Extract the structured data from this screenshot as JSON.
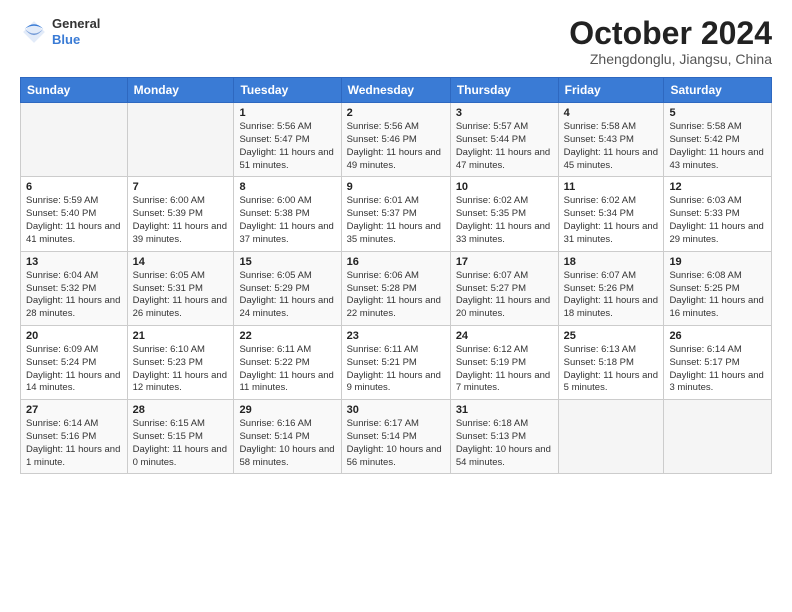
{
  "logo": {
    "general": "General",
    "blue": "Blue"
  },
  "title": "October 2024",
  "location": "Zhengdonglu, Jiangsu, China",
  "weekdays": [
    "Sunday",
    "Monday",
    "Tuesday",
    "Wednesday",
    "Thursday",
    "Friday",
    "Saturday"
  ],
  "weeks": [
    [
      {
        "day": "",
        "info": ""
      },
      {
        "day": "",
        "info": ""
      },
      {
        "day": "1",
        "info": "Sunrise: 5:56 AM\nSunset: 5:47 PM\nDaylight: 11 hours and 51 minutes."
      },
      {
        "day": "2",
        "info": "Sunrise: 5:56 AM\nSunset: 5:46 PM\nDaylight: 11 hours and 49 minutes."
      },
      {
        "day": "3",
        "info": "Sunrise: 5:57 AM\nSunset: 5:44 PM\nDaylight: 11 hours and 47 minutes."
      },
      {
        "day": "4",
        "info": "Sunrise: 5:58 AM\nSunset: 5:43 PM\nDaylight: 11 hours and 45 minutes."
      },
      {
        "day": "5",
        "info": "Sunrise: 5:58 AM\nSunset: 5:42 PM\nDaylight: 11 hours and 43 minutes."
      }
    ],
    [
      {
        "day": "6",
        "info": "Sunrise: 5:59 AM\nSunset: 5:40 PM\nDaylight: 11 hours and 41 minutes."
      },
      {
        "day": "7",
        "info": "Sunrise: 6:00 AM\nSunset: 5:39 PM\nDaylight: 11 hours and 39 minutes."
      },
      {
        "day": "8",
        "info": "Sunrise: 6:00 AM\nSunset: 5:38 PM\nDaylight: 11 hours and 37 minutes."
      },
      {
        "day": "9",
        "info": "Sunrise: 6:01 AM\nSunset: 5:37 PM\nDaylight: 11 hours and 35 minutes."
      },
      {
        "day": "10",
        "info": "Sunrise: 6:02 AM\nSunset: 5:35 PM\nDaylight: 11 hours and 33 minutes."
      },
      {
        "day": "11",
        "info": "Sunrise: 6:02 AM\nSunset: 5:34 PM\nDaylight: 11 hours and 31 minutes."
      },
      {
        "day": "12",
        "info": "Sunrise: 6:03 AM\nSunset: 5:33 PM\nDaylight: 11 hours and 29 minutes."
      }
    ],
    [
      {
        "day": "13",
        "info": "Sunrise: 6:04 AM\nSunset: 5:32 PM\nDaylight: 11 hours and 28 minutes."
      },
      {
        "day": "14",
        "info": "Sunrise: 6:05 AM\nSunset: 5:31 PM\nDaylight: 11 hours and 26 minutes."
      },
      {
        "day": "15",
        "info": "Sunrise: 6:05 AM\nSunset: 5:29 PM\nDaylight: 11 hours and 24 minutes."
      },
      {
        "day": "16",
        "info": "Sunrise: 6:06 AM\nSunset: 5:28 PM\nDaylight: 11 hours and 22 minutes."
      },
      {
        "day": "17",
        "info": "Sunrise: 6:07 AM\nSunset: 5:27 PM\nDaylight: 11 hours and 20 minutes."
      },
      {
        "day": "18",
        "info": "Sunrise: 6:07 AM\nSunset: 5:26 PM\nDaylight: 11 hours and 18 minutes."
      },
      {
        "day": "19",
        "info": "Sunrise: 6:08 AM\nSunset: 5:25 PM\nDaylight: 11 hours and 16 minutes."
      }
    ],
    [
      {
        "day": "20",
        "info": "Sunrise: 6:09 AM\nSunset: 5:24 PM\nDaylight: 11 hours and 14 minutes."
      },
      {
        "day": "21",
        "info": "Sunrise: 6:10 AM\nSunset: 5:23 PM\nDaylight: 11 hours and 12 minutes."
      },
      {
        "day": "22",
        "info": "Sunrise: 6:11 AM\nSunset: 5:22 PM\nDaylight: 11 hours and 11 minutes."
      },
      {
        "day": "23",
        "info": "Sunrise: 6:11 AM\nSunset: 5:21 PM\nDaylight: 11 hours and 9 minutes."
      },
      {
        "day": "24",
        "info": "Sunrise: 6:12 AM\nSunset: 5:19 PM\nDaylight: 11 hours and 7 minutes."
      },
      {
        "day": "25",
        "info": "Sunrise: 6:13 AM\nSunset: 5:18 PM\nDaylight: 11 hours and 5 minutes."
      },
      {
        "day": "26",
        "info": "Sunrise: 6:14 AM\nSunset: 5:17 PM\nDaylight: 11 hours and 3 minutes."
      }
    ],
    [
      {
        "day": "27",
        "info": "Sunrise: 6:14 AM\nSunset: 5:16 PM\nDaylight: 11 hours and 1 minute."
      },
      {
        "day": "28",
        "info": "Sunrise: 6:15 AM\nSunset: 5:15 PM\nDaylight: 11 hours and 0 minutes."
      },
      {
        "day": "29",
        "info": "Sunrise: 6:16 AM\nSunset: 5:14 PM\nDaylight: 10 hours and 58 minutes."
      },
      {
        "day": "30",
        "info": "Sunrise: 6:17 AM\nSunset: 5:14 PM\nDaylight: 10 hours and 56 minutes."
      },
      {
        "day": "31",
        "info": "Sunrise: 6:18 AM\nSunset: 5:13 PM\nDaylight: 10 hours and 54 minutes."
      },
      {
        "day": "",
        "info": ""
      },
      {
        "day": "",
        "info": ""
      }
    ]
  ]
}
